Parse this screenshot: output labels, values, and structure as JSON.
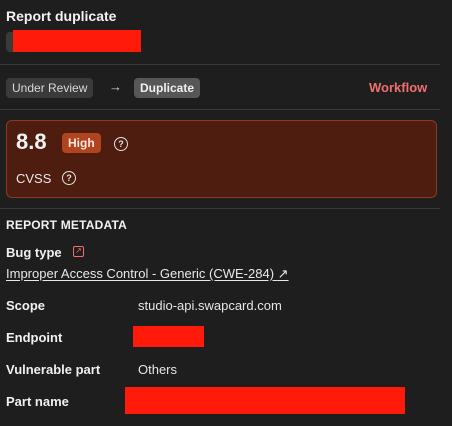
{
  "header": {
    "title": "Report duplicate"
  },
  "workflow": {
    "from_state": "Under Review",
    "arrow": "→",
    "to_state": "Duplicate",
    "link_label": "Workflow",
    "link_color": "#f26e6e"
  },
  "cvss": {
    "score": "8.8",
    "severity": "High",
    "label": "CVSS",
    "help_glyph": "?",
    "severity_color": "#b0441f"
  },
  "metadata": {
    "section_title": "REPORT METADATA",
    "bug_type_label": "Bug type",
    "bug_type_value": "Improper Access Control - Generic (CWE-284)",
    "bug_type_link_glyph": "↗",
    "scope_label": "Scope",
    "scope_value": "studio-api.swapcard.com",
    "endpoint_label": "Endpoint",
    "vulnerable_part_label": "Vulnerable part",
    "vulnerable_part_value": "Others",
    "part_name_label": "Part name"
  },
  "icons": [
    "help-icon",
    "external-link-icon",
    "arrow-right-icon"
  ],
  "redaction_color": "#ff1a0a"
}
